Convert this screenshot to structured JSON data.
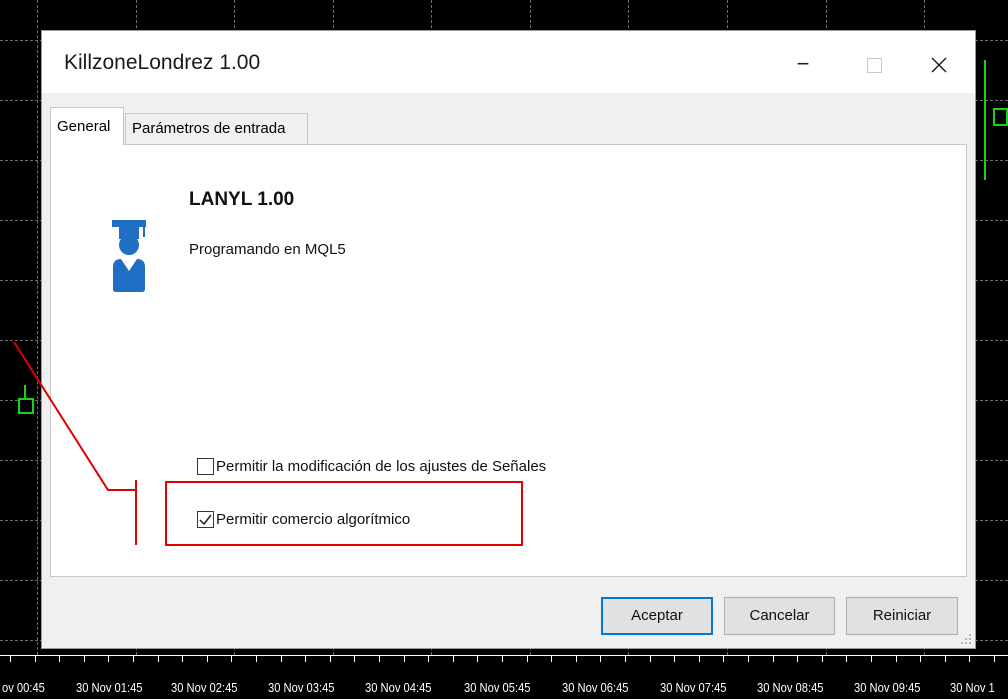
{
  "window": {
    "title": "KillzoneLondrez 1.00",
    "minimize_symbol": "−",
    "maximize_symbol": "☐",
    "close_symbol": "✕"
  },
  "tabs": [
    {
      "label": "General",
      "active": true
    },
    {
      "label": "Parámetros de entrada",
      "active": false
    }
  ],
  "general": {
    "icon": "user-graduate-icon",
    "app_name": "LANYL 1.00",
    "description": "Programando en MQL5",
    "options": [
      {
        "label": "Permitir la modificación de los ajustes de Señales",
        "checked": false
      },
      {
        "label": "Permitir comercio algorítmico",
        "checked": true
      }
    ]
  },
  "buttons": {
    "ok": "Aceptar",
    "cancel": "Cancelar",
    "reset": "Reiniciar"
  },
  "time_axis": {
    "labels": [
      "ov 00:45",
      "30 Nov 01:45",
      "30 Nov 02:45",
      "30 Nov 03:45",
      "30 Nov 04:45",
      "30 Nov 05:45",
      "30 Nov 06:45",
      "30 Nov 07:45",
      "30 Nov 08:45",
      "30 Nov 09:45",
      "30 Nov 1"
    ]
  },
  "colors": {
    "chart_background": "#000000",
    "candle": "#19d119",
    "annotation": "#e00000",
    "accent": "#0078d7",
    "icon_blue": "#1f6fc5"
  }
}
